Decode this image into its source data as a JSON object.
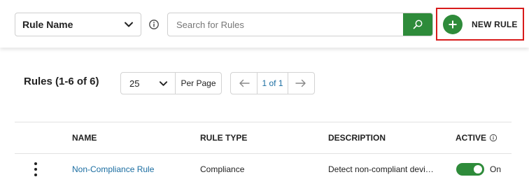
{
  "filter": {
    "field_selected": "Rule Name",
    "search_placeholder": "Search for Rules",
    "search_value": "",
    "new_rule_label": "NEW RULE"
  },
  "list": {
    "title": "Rules (1-6 of 6)",
    "per_page_value": "25",
    "per_page_label": "Per Page",
    "page_indicator": "1 of 1"
  },
  "table": {
    "columns": [
      "NAME",
      "RULE TYPE",
      "DESCRIPTION",
      "ACTIVE"
    ],
    "rows": [
      {
        "name": "Non-Compliance Rule",
        "rule_type": "Compliance",
        "description": "Detect non-compliant devices",
        "active": true,
        "active_label": "On"
      }
    ]
  },
  "colors": {
    "accent_green": "#2e8b3a",
    "link_blue": "#1a6da1",
    "highlight_red": "#d81b1b"
  },
  "icons": [
    "chevron-down-icon",
    "info-icon",
    "search-icon",
    "plus-icon",
    "arrow-left-icon",
    "arrow-right-icon",
    "kebab-menu-icon"
  ]
}
